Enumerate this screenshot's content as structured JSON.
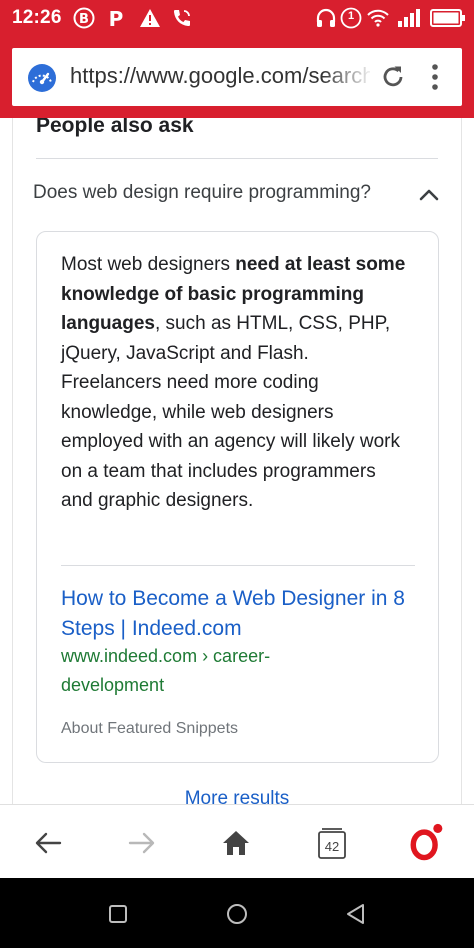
{
  "status_bar": {
    "time": "12:26",
    "signal_badge": "1"
  },
  "url_bar": {
    "url": "https://www.google.com/search"
  },
  "content": {
    "section_title": "People also ask",
    "question": "Does web design require programming?",
    "snippet": {
      "text_1": "Most web designers ",
      "bold_1": "need at least some knowledge of basic programming languages",
      "text_2": ", such as HTML, CSS, PHP, jQuery, JavaScript and Flash. Freelancers need more coding knowledge, while web designers employed with an agency will likely work on a team that includes programmers and graphic designers.",
      "result_title": "How to Become a Web Designer in 8 Steps | Indeed.com",
      "result_url": "www.indeed.com › career-development",
      "about": "About Featured Snippets"
    },
    "more_results": "More results"
  },
  "toolbar": {
    "tabs_count": "42"
  },
  "colors": {
    "status_red": "#d81f2e",
    "link_blue": "#1a5fc7",
    "url_green": "#1e7a34",
    "opera_red": "#e0161f"
  }
}
